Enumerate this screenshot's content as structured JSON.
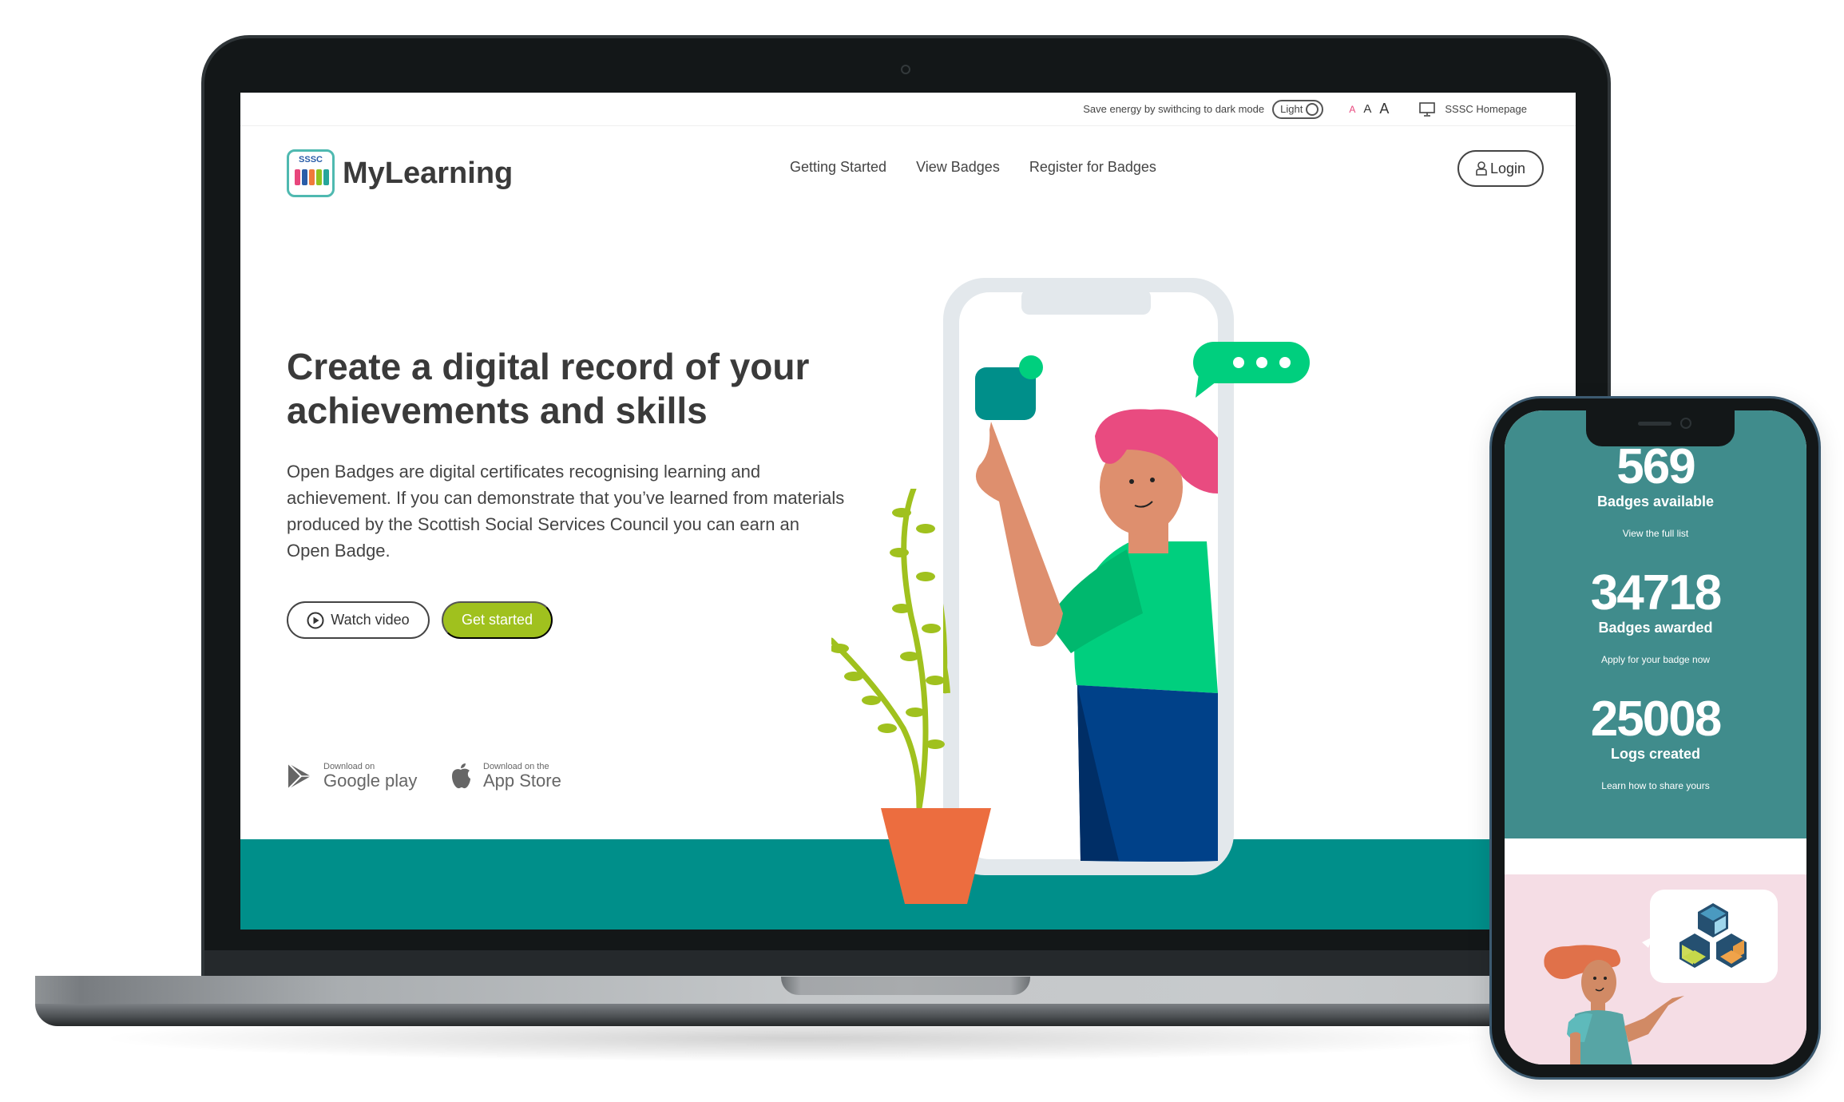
{
  "topbar": {
    "energy_text": "Save energy by swithcing to dark mode",
    "theme_toggle_label": "Light",
    "font_sizes": [
      "A",
      "A",
      "A"
    ],
    "homepage_link": "SSSC Homepage"
  },
  "brand": {
    "logo_badge": "SSSC",
    "name": "MyLearning"
  },
  "nav": {
    "items": [
      "Getting Started",
      "View Badges",
      "Register for Badges"
    ],
    "login_label": "Login"
  },
  "hero": {
    "title": "Create a digital record of your achievements and skills",
    "body": "Open Badges are digital certificates recognising learning and achievement. If you can demonstrate that you’ve learned from materials produced by the Scottish Social Services Council you can earn an Open Badge.",
    "watch_video_label": "Watch video",
    "get_started_label": "Get started"
  },
  "stores": {
    "google": {
      "small": "Download on",
      "big": "Google play"
    },
    "apple": {
      "small": "Download on the",
      "big": "App Store"
    }
  },
  "phone": {
    "stats": [
      {
        "value": "569",
        "label": "Badges available",
        "link": "View the full list"
      },
      {
        "value": "34718",
        "label": "Badges awarded",
        "link": "Apply for your badge now"
      },
      {
        "value": "25008",
        "label": "Logs created",
        "link": "Learn how to share yours"
      }
    ]
  },
  "colors": {
    "teal": "#008f8a",
    "phone_teal": "#408c8c",
    "accent_green": "#a0c11e",
    "pink_accent": "#e8467c"
  }
}
